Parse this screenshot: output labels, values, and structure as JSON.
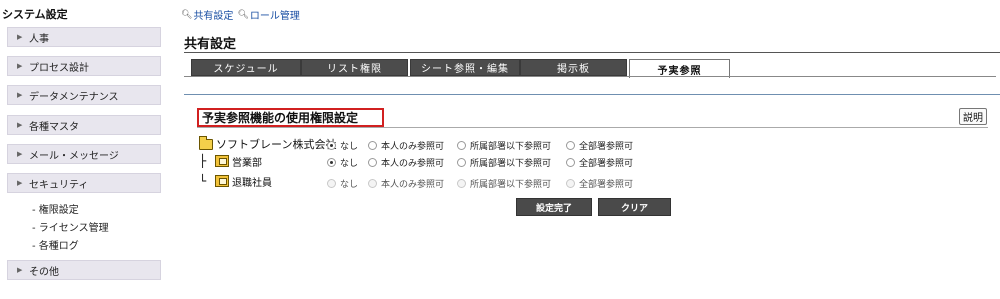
{
  "sidebar": {
    "title": "システム設定",
    "items": [
      {
        "label": "人事"
      },
      {
        "label": "プロセス設計"
      },
      {
        "label": "データメンテナンス"
      },
      {
        "label": "各種マスタ"
      },
      {
        "label": "メール・メッセージ"
      },
      {
        "label": "セキュリティ"
      },
      {
        "label": "その他"
      }
    ],
    "subitems": [
      "- 権限設定",
      "- ライセンス管理",
      "- 各種ログ"
    ]
  },
  "top_links": [
    {
      "label": "共有設定",
      "icon": "key-icon"
    },
    {
      "label": "ロール管理",
      "icon": "key-icon"
    }
  ],
  "page_title": "共有設定",
  "tabs": [
    {
      "label": "スケジュール",
      "active": false
    },
    {
      "label": "リスト権限",
      "active": false
    },
    {
      "label": "シート参照・編集",
      "active": false
    },
    {
      "label": "掲示板",
      "active": false
    },
    {
      "label": "予実参照",
      "active": true
    }
  ],
  "section": {
    "title": "予実参照機能の使用権限設定",
    "help_label": "説明"
  },
  "options": [
    "なし",
    "本人のみ参照可",
    "所属部署以下参照可",
    "全部署参照可"
  ],
  "rows": [
    {
      "label": "ソフトブレーン株式会社",
      "selected": "なし",
      "enabled": true
    },
    {
      "label": "営業部",
      "selected": "なし",
      "enabled": true
    },
    {
      "label": "退職社員",
      "selected": null,
      "enabled": false
    }
  ],
  "buttons": {
    "done": "設定完了",
    "clear": "クリア"
  },
  "colors": {
    "accent_red": "#d12020",
    "tab_dark": "#4c4c4c",
    "link_blue": "#1a4fa3",
    "sidebar_bg": "#e8e6ee"
  }
}
